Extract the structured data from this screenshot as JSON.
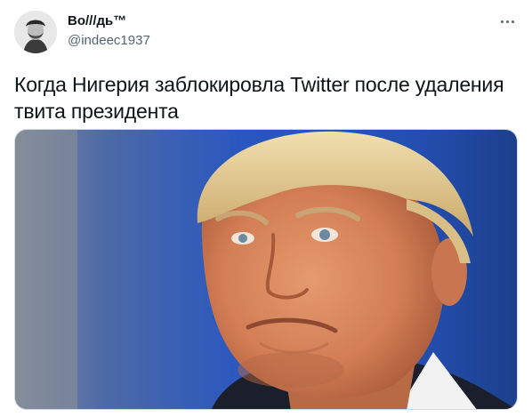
{
  "tweet": {
    "author": {
      "display_name": "Во///дь™",
      "handle": "@indeec1937",
      "avatar_icon": "avatar-portrait-icon"
    },
    "more_icon": "more-options-icon",
    "text": "Когда Нигерия заблокировла Twitter после удаления твита президента",
    "media": {
      "type": "photo"
    }
  },
  "colors": {
    "text_primary": "#0f1419",
    "text_secondary": "#536471",
    "border": "#cfd9de",
    "photo_background": "#2b57b8"
  }
}
